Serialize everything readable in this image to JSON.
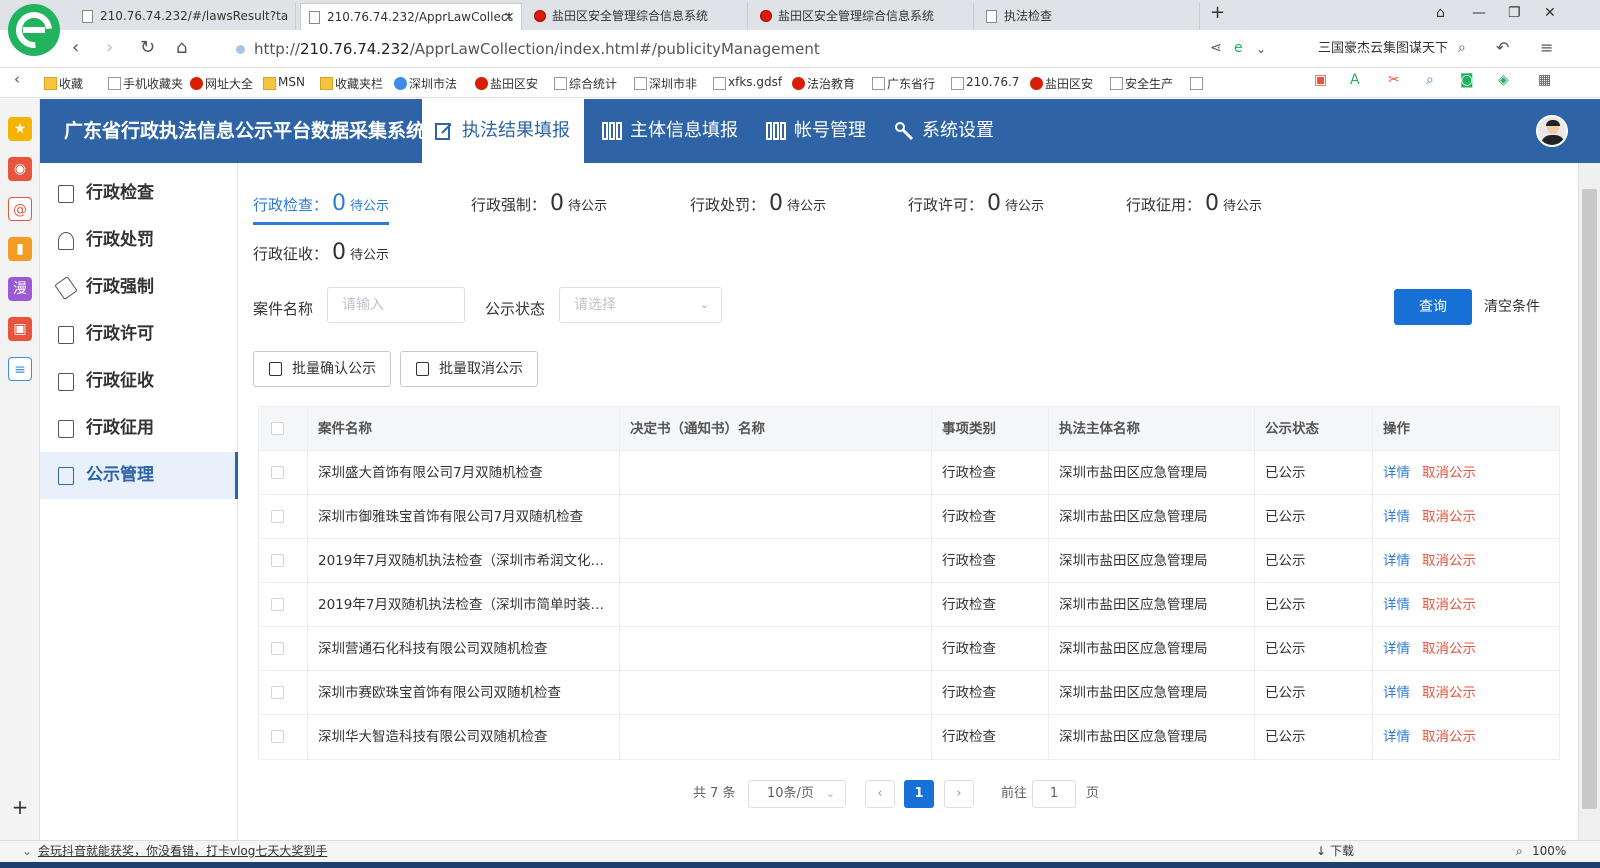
{
  "browser": {
    "tabs": [
      {
        "title": "210.76.74.232/#/lawsResult?ta",
        "icon": "page"
      },
      {
        "title": "210.76.74.232/ApprLawCollect",
        "icon": "page",
        "active": true
      },
      {
        "title": "盐田区安全管理综合信息系统",
        "icon": "red-dot"
      },
      {
        "title": "盐田区安全管理综合信息系统",
        "icon": "red-dot"
      },
      {
        "title": "执法检查",
        "icon": "page"
      }
    ],
    "new_tab": "+",
    "url_prefix": "http://",
    "url_host": "210.76.74.232",
    "url_path": "/ApprLawCollection/index.html#/publicityManagement",
    "search_text": "三国豪杰云集图谋天下",
    "bookmarks": [
      "收藏",
      "手机收藏夹",
      "网址大全",
      "MSN",
      "收藏夹栏",
      "深圳市法",
      "盐田区安",
      "综合统计",
      "深圳市非",
      "xfks.gdsf",
      "法治教育",
      "广东省行",
      "210.76.7",
      "盐田区安",
      "安全生产"
    ],
    "bookmarks_more": "»"
  },
  "app": {
    "title": "广东省行政执法信息公示平台数据采集系统",
    "nav": [
      {
        "label": "执法结果填报",
        "icon": "edit-icon",
        "active": true
      },
      {
        "label": "主体信息填报",
        "icon": "columns-icon"
      },
      {
        "label": "帐号管理",
        "icon": "columns-icon"
      },
      {
        "label": "系统设置",
        "icon": "wrench-icon"
      }
    ]
  },
  "sidebar": {
    "items": [
      {
        "label": "行政检查"
      },
      {
        "label": "行政处罚"
      },
      {
        "label": "行政强制"
      },
      {
        "label": "行政许可"
      },
      {
        "label": "行政征收"
      },
      {
        "label": "行政征用"
      },
      {
        "label": "公示管理",
        "active": true
      }
    ]
  },
  "stats": [
    {
      "label": "行政检查：",
      "count": "0",
      "suffix": "待公示",
      "active": true
    },
    {
      "label": "行政强制：",
      "count": "0",
      "suffix": "待公示"
    },
    {
      "label": "行政处罚：",
      "count": "0",
      "suffix": "待公示"
    },
    {
      "label": "行政许可：",
      "count": "0",
      "suffix": "待公示"
    },
    {
      "label": "行政征用：",
      "count": "0",
      "suffix": "待公示"
    },
    {
      "label": "行政征收：",
      "count": "0",
      "suffix": "待公示"
    }
  ],
  "filters": {
    "case_name_label": "案件名称",
    "case_name_placeholder": "请输入",
    "status_label": "公示状态",
    "status_placeholder": "请选择",
    "query_button": "查询",
    "clear_button": "清空条件"
  },
  "batch": {
    "confirm": "批量确认公示",
    "cancel": "批量取消公示"
  },
  "table": {
    "headers": [
      "案件名称",
      "决定书（通知书）名称",
      "事项类别",
      "执法主体名称",
      "公示状态",
      "操作"
    ],
    "rows": [
      {
        "case": "深圳盛大首饰有限公司7月双随机检查",
        "decision": "",
        "category": "行政检查",
        "agency": "深圳市盐田区应急管理局",
        "status": "已公示"
      },
      {
        "case": "深圳市御雅珠宝首饰有限公司7月双随机检查",
        "decision": "",
        "category": "行政检查",
        "agency": "深圳市盐田区应急管理局",
        "status": "已公示"
      },
      {
        "case": "2019年7月双随机执法检查（深圳市希润文化…",
        "decision": "",
        "category": "行政检查",
        "agency": "深圳市盐田区应急管理局",
        "status": "已公示"
      },
      {
        "case": "2019年7月双随机执法检查（深圳市简单时装…",
        "decision": "",
        "category": "行政检查",
        "agency": "深圳市盐田区应急管理局",
        "status": "已公示"
      },
      {
        "case": "深圳营通石化科技有限公司双随机检查",
        "decision": "",
        "category": "行政检查",
        "agency": "深圳市盐田区应急管理局",
        "status": "已公示"
      },
      {
        "case": "深圳市赛欧珠宝首饰有限公司双随机检查",
        "decision": "",
        "category": "行政检查",
        "agency": "深圳市盐田区应急管理局",
        "status": "已公示"
      },
      {
        "case": "深圳华大智造科技有限公司双随机检查",
        "decision": "",
        "category": "行政检查",
        "agency": "深圳市盐田区应急管理局",
        "status": "已公示"
      }
    ],
    "action_detail": "详情",
    "action_cancel": "取消公示"
  },
  "pagination": {
    "total": "共 7 条",
    "page_size": "10条/页",
    "current_page": "1",
    "goto_prefix": "前往",
    "goto_value": "1",
    "goto_suffix": "页"
  },
  "statusbar": {
    "news": "会玩抖音就能获奖，你没看错，打卡vlog七天大奖到手",
    "download": "下载",
    "zoom": "100%"
  },
  "colors": {
    "header_bg": "#2e64a6",
    "primary": "#1670d6",
    "link": "#2e7bd6",
    "danger": "#e8543d"
  }
}
